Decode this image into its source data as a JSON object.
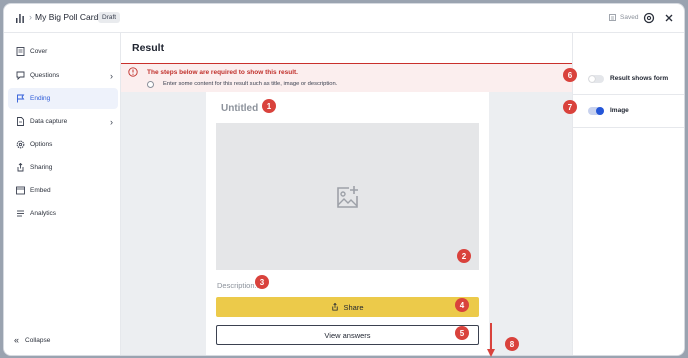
{
  "app": {
    "title": "My Big Poll Card",
    "status_badge": "Draft",
    "saved_label": "Saved",
    "logo_icon": "bar-chart-icon"
  },
  "sidebar": {
    "items": [
      {
        "label": "Cover",
        "icon": "page-icon",
        "has_submenu": false,
        "active": false
      },
      {
        "label": "Questions",
        "icon": "chat-icon",
        "has_submenu": true,
        "active": false
      },
      {
        "label": "Ending",
        "icon": "flag-icon",
        "has_submenu": false,
        "active": true
      },
      {
        "label": "Data capture",
        "icon": "document-icon",
        "has_submenu": true,
        "active": false
      },
      {
        "label": "Options",
        "icon": "gear-icon",
        "has_submenu": false,
        "active": false
      },
      {
        "label": "Sharing",
        "icon": "share-icon",
        "has_submenu": false,
        "active": false
      },
      {
        "label": "Embed",
        "icon": "embed-icon",
        "has_submenu": false,
        "active": false
      },
      {
        "label": "Analytics",
        "icon": "list-icon",
        "has_submenu": false,
        "active": false
      }
    ],
    "collapse_label": "Collapse"
  },
  "main": {
    "title": "Result",
    "alert": {
      "title": "The steps below are required to show this result.",
      "step": "Enter some content for this result such as title, image or description."
    },
    "card": {
      "title": "Untitled",
      "description_placeholder": "Description...",
      "share_label": "Share",
      "view_answers_label": "View answers"
    }
  },
  "right_panel": {
    "result_shows_form": {
      "label": "Result shows form",
      "enabled": false
    },
    "image": {
      "label": "Image",
      "enabled": true
    }
  },
  "annotations": [
    "1",
    "2",
    "3",
    "4",
    "5",
    "6",
    "7",
    "8"
  ],
  "colors": {
    "accent": "#2456d8",
    "error": "#c0302b",
    "share_button": "#ecca4a",
    "badge": "#d9423c"
  }
}
